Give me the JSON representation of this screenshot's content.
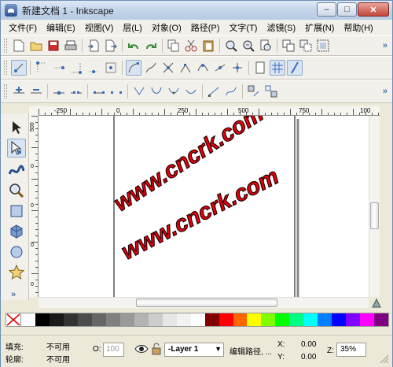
{
  "window": {
    "title": "新建文档 1 - Inkscape",
    "minimize": "–",
    "maximize": "□",
    "close": "✕"
  },
  "menu": [
    "文件(F)",
    "编辑(E)",
    "视图(V)",
    "层(L)",
    "对象(O)",
    "路径(P)",
    "文字(T)",
    "滤镜(S)",
    "扩展(N)",
    "帮助(H)"
  ],
  "rulers": {
    "h_ticks": [
      "-250",
      "0",
      "250",
      "500",
      "750",
      "100"
    ],
    "v_ticks": [
      "500",
      "0",
      "0",
      "0",
      "0"
    ]
  },
  "canvas": {
    "watermark_1": "www.cncrk.com",
    "watermark_2": "www.cncrk.com",
    "watermark_color": "#e8000e"
  },
  "palette_colors": [
    "#ffffff",
    "#000000",
    "#1a1a1a",
    "#333333",
    "#4d4d4d",
    "#666666",
    "#808080",
    "#999999",
    "#b3b3b3",
    "#cccccc",
    "#e6e6e6",
    "#f2f2f2",
    "#ffffff",
    "#800000",
    "#ff0000",
    "#ff6600",
    "#ffff00",
    "#80ff00",
    "#00ff00",
    "#00ff80",
    "#00ffff",
    "#0080ff",
    "#0000ff",
    "#8000ff",
    "#ff00ff",
    "#800080"
  ],
  "status": {
    "fill_label": "填充:",
    "fill_value": "不可用",
    "stroke_label": "轮廓:",
    "stroke_value": "不可用",
    "opacity_label": "O:",
    "opacity_value": "100",
    "layer_value": "-Layer 1",
    "message": "编辑路径, ...",
    "x_label": "X:",
    "x_value": "0.00",
    "y_label": "Y:",
    "y_value": "0.00",
    "zoom_label": "Z:",
    "zoom_value": "35%"
  }
}
